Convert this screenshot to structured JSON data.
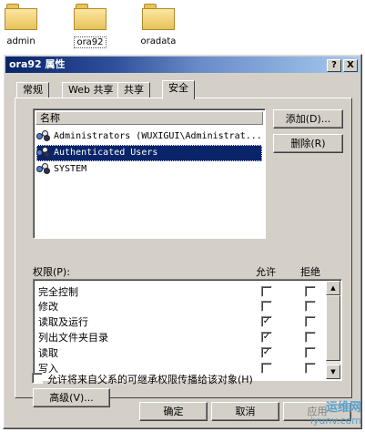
{
  "desktop": {
    "folders": [
      {
        "label": "admin"
      },
      {
        "label": "ora92"
      },
      {
        "label": "oradata"
      }
    ]
  },
  "dialog": {
    "title": "ora92 属性",
    "help_btn": "?",
    "close_btn": "X",
    "tabs": [
      "常规",
      "Web 共享",
      "共享",
      "安全"
    ],
    "active_tab": "安全",
    "names_header": "名称",
    "users": [
      "Administrators (WUXIGUI\\Administrat...",
      "Authenticated Users",
      "SYSTEM"
    ],
    "add_button": "添加(D)...",
    "remove_button": "删除(R)",
    "permissions_label": "权限(P):",
    "allow_header": "允许",
    "deny_header": "拒绝",
    "permissions": [
      {
        "name": "完全控制",
        "allow": "",
        "deny": ""
      },
      {
        "name": "修改",
        "allow": "",
        "deny": ""
      },
      {
        "name": "读取及运行",
        "allow": "✓",
        "deny": ""
      },
      {
        "name": "列出文件夹目录",
        "allow": "✓",
        "deny": ""
      },
      {
        "name": "读取",
        "allow": "✓",
        "deny": ""
      },
      {
        "name": "写入",
        "allow": "",
        "deny": ""
      }
    ],
    "advanced_button": "高级(V)...",
    "inherit_label": "允许将来自父系的可继承权限传播给该对象(H)",
    "ok_button": "确定",
    "cancel_button": "取消",
    "apply_button": "应用"
  },
  "watermark": {
    "line1": "运维网",
    "line2": "iyunv.com"
  }
}
